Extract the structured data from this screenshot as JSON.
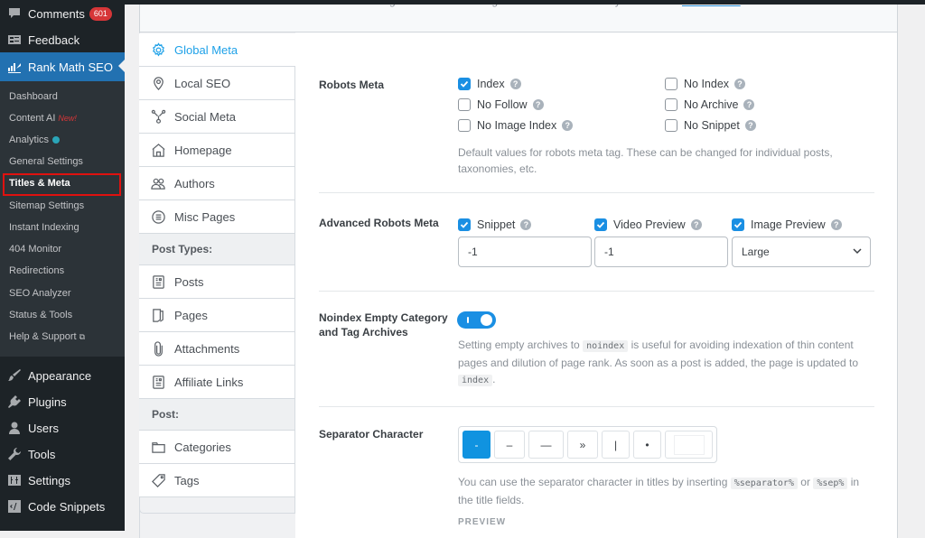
{
  "wp_menu": {
    "top_items": [
      {
        "label": "Comments",
        "icon": "comments-icon",
        "badge": "601"
      },
      {
        "label": "Feedback",
        "icon": "feedback-icon"
      },
      {
        "label": "Rank Math SEO",
        "icon": "rank-math-icon",
        "active": true
      }
    ],
    "submenu": [
      {
        "label": "Dashboard"
      },
      {
        "label": "Content AI",
        "tag": "New!"
      },
      {
        "label": "Analytics",
        "status_dot": true
      },
      {
        "label": "General Settings"
      },
      {
        "label": "Titles & Meta",
        "current": true
      },
      {
        "label": "Sitemap Settings"
      },
      {
        "label": "Instant Indexing"
      },
      {
        "label": "404 Monitor"
      },
      {
        "label": "Redirections"
      },
      {
        "label": "SEO Analyzer"
      },
      {
        "label": "Status & Tools"
      },
      {
        "label": "Help & Support",
        "external": "⧉"
      }
    ],
    "bottom_items": [
      {
        "label": "Appearance",
        "icon": "paintbrush-icon"
      },
      {
        "label": "Plugins",
        "icon": "plugins-icon"
      },
      {
        "label": "Users",
        "icon": "users-icon"
      },
      {
        "label": "Tools",
        "icon": "wrench-icon"
      },
      {
        "label": "Settings",
        "icon": "settings-icon"
      },
      {
        "label": "Code Snippets",
        "icon": "code-snippets-icon"
      }
    ]
  },
  "header": {
    "text": "change Global Meta settings that take effect across your website.",
    "link": "Learn more."
  },
  "tabs": [
    {
      "label": "Global Meta",
      "icon": "gear-icon",
      "active": true
    },
    {
      "label": "Local SEO",
      "icon": "location-pin-icon"
    },
    {
      "label": "Social Meta",
      "icon": "social-share-icon"
    },
    {
      "label": "Homepage",
      "icon": "home-icon"
    },
    {
      "label": "Authors",
      "icon": "authors-icon"
    },
    {
      "label": "Misc Pages",
      "icon": "list-circle-icon"
    },
    {
      "section": "Post Types:"
    },
    {
      "label": "Posts",
      "icon": "posts-icon"
    },
    {
      "label": "Pages",
      "icon": "pages-icon"
    },
    {
      "label": "Attachments",
      "icon": "paperclip-icon"
    },
    {
      "label": "Affiliate Links",
      "icon": "affiliate-links-icon"
    },
    {
      "section": "Post:"
    },
    {
      "label": "Categories",
      "icon": "folder-icon"
    },
    {
      "label": "Tags",
      "icon": "tag-icon"
    }
  ],
  "robots_meta": {
    "label": "Robots Meta",
    "options": [
      {
        "label": "Index",
        "checked": true
      },
      {
        "label": "No Follow",
        "checked": false
      },
      {
        "label": "No Image Index",
        "checked": false
      },
      {
        "label": "No Index",
        "checked": false
      },
      {
        "label": "No Archive",
        "checked": false
      },
      {
        "label": "No Snippet",
        "checked": false
      }
    ],
    "description_line1": "Default values for robots meta tag. These can be changed for individual posts,",
    "description_line2": "taxonomies, etc."
  },
  "advanced_robots": {
    "label": "Advanced Robots Meta",
    "snippet": {
      "label": "Snippet",
      "checked": true,
      "value": "-1"
    },
    "video_preview": {
      "label": "Video Preview",
      "checked": true,
      "value": "-1"
    },
    "image_preview": {
      "label": "Image Preview",
      "checked": true,
      "value": "Large"
    }
  },
  "noindex_empty": {
    "label_line1": "Noindex Empty Category",
    "label_line2": "and Tag Archives",
    "enabled": true,
    "desc_a": "Setting empty archives to ",
    "code_a": "noindex",
    "desc_b": " is useful for avoiding indexation of thin content",
    "desc_line2": "pages and dilution of page rank. As soon as a post is added, the page is updated to",
    "code_b": "index",
    "desc_end": "."
  },
  "separator": {
    "label": "Separator Character",
    "options": [
      "-",
      "–",
      "—",
      "»",
      "|",
      "•",
      ""
    ],
    "selected_index": 0,
    "desc_a": "You can use the separator character in titles by inserting ",
    "code_a": "%separator%",
    "desc_or": " or ",
    "code_b": "%sep%",
    "desc_b": " in",
    "desc_line2": "the title fields.",
    "preview_label": "PREVIEW"
  },
  "colors": {
    "accent": "#1a8fe3",
    "wp_admin_bg": "#1d2327",
    "wp_active": "#2271b1",
    "highlight_box": "#e0110f"
  }
}
